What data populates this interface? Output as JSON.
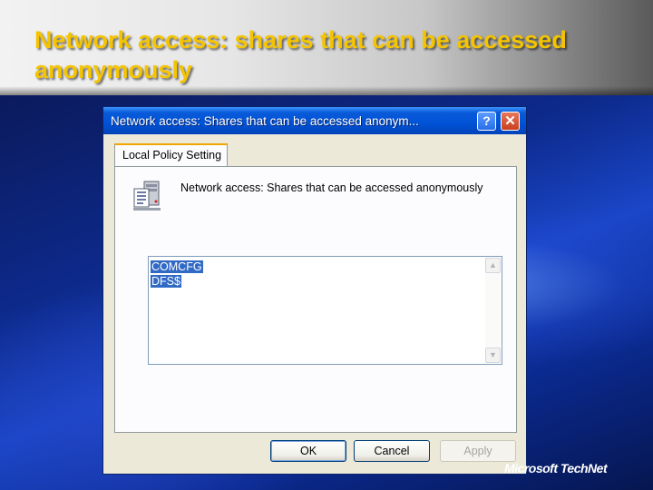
{
  "slide": {
    "title": "Network access: shares that can be accessed anonymously",
    "brand": "Microsoft TechNet"
  },
  "dialog": {
    "title": "Network access: Shares that can be accessed anonym...",
    "help_label": "?",
    "close_label": "✕",
    "tab_label": "Local Policy Setting",
    "policy_name": "Network access: Shares that can be accessed anonymously",
    "list_values": [
      "COMCFG",
      "DFS$"
    ],
    "buttons": {
      "ok": "OK",
      "cancel": "Cancel",
      "apply": "Apply"
    },
    "icons": {
      "policy": "server-policy-icon",
      "scroll_up": "scroll-up-icon",
      "scroll_down": "scroll-down-icon"
    }
  }
}
